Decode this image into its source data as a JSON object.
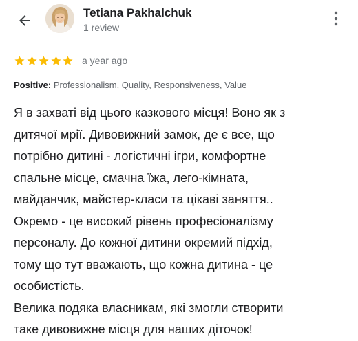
{
  "reviewer": {
    "name": "Tetiana Pakhalchuk",
    "review_count": "1 review"
  },
  "icons": {
    "back": "arrow-back-icon",
    "more": "more-vert-icon",
    "star": "star-icon"
  },
  "rating": {
    "stars": 5,
    "max_stars": 5,
    "date": "a year ago"
  },
  "positive": {
    "label": "Positive:",
    "values": "Professionalism, Quality, Responsiveness, Value"
  },
  "review": {
    "lines": [
      "Я в захваті від цього казкового місця! Воно як з",
      "дитячої мрії. Дивовижний замок, де є все, що",
      "потрібно дитині - логістичні ігри, комфортне",
      "спальне місце, смачна їжа, лего-кімната,",
      "майданчик, майстер-класи та цікаві заняття..",
      "Окремо - це високий рівень професіоналізму",
      "персоналу. До кожної дитини окремий підхід,",
      "тому що тут вважають, що кожна дитина - це",
      "особистість.",
      "Велика подяка власникам, які змогли створити",
      "таке дивовижне місця для наших діточок!"
    ]
  },
  "colors": {
    "star": "#fbbc04",
    "text_primary": "#202124",
    "text_secondary": "#70757a",
    "icon": "#5f6368"
  }
}
